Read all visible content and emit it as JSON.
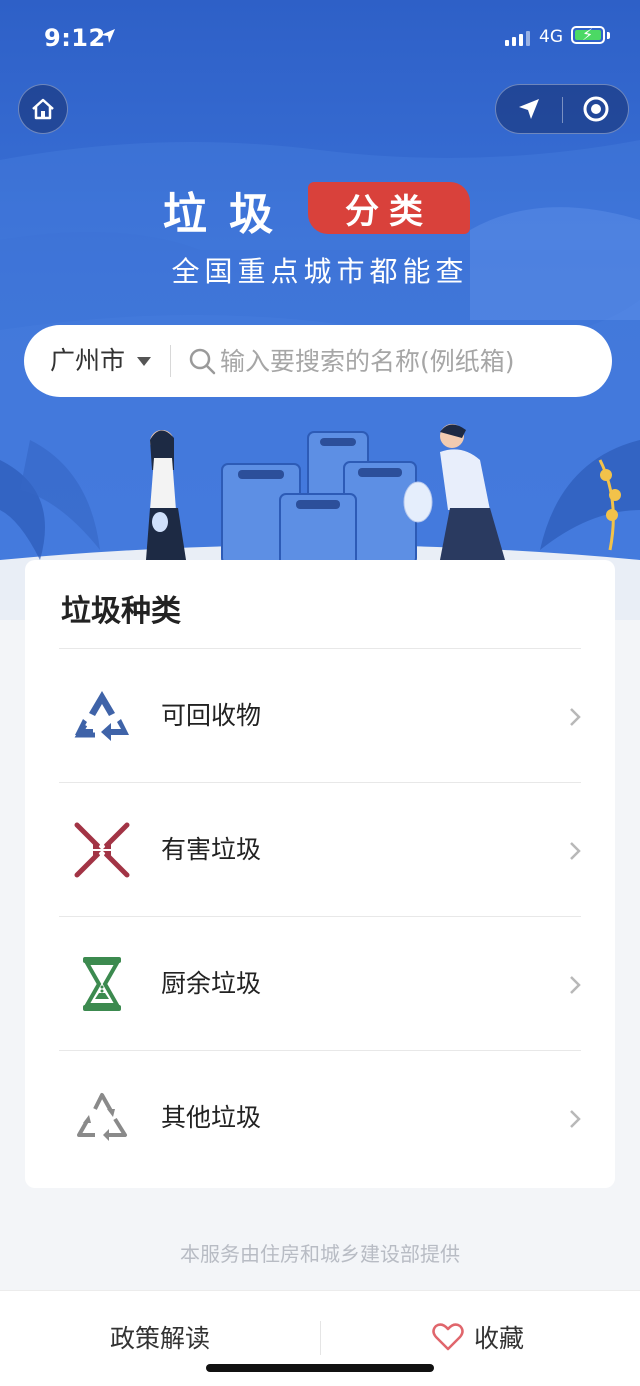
{
  "status_bar": {
    "time": "9:12",
    "network": "4G"
  },
  "header": {
    "title_main": "垃圾",
    "title_tag": "分类",
    "subtitle": "全国重点城市都能查"
  },
  "search": {
    "city": "广州市",
    "placeholder": "输入要搜索的名称(例纸箱)"
  },
  "categories": {
    "title": "垃圾种类",
    "items": [
      {
        "label": "可回收物",
        "icon": "recycle-icon",
        "color": "#3f63a8"
      },
      {
        "label": "有害垃圾",
        "icon": "hazard-x-icon",
        "color": "#a23445"
      },
      {
        "label": "厨余垃圾",
        "icon": "hourglass-icon",
        "color": "#3c8a4f"
      },
      {
        "label": "其他垃圾",
        "icon": "recycle-outline-icon",
        "color": "#8a8a8a"
      }
    ]
  },
  "footer_note": "本服务由住房和城乡建设部提供",
  "bottom_bar": {
    "policy_label": "政策解读",
    "favorite_label": "收藏"
  }
}
